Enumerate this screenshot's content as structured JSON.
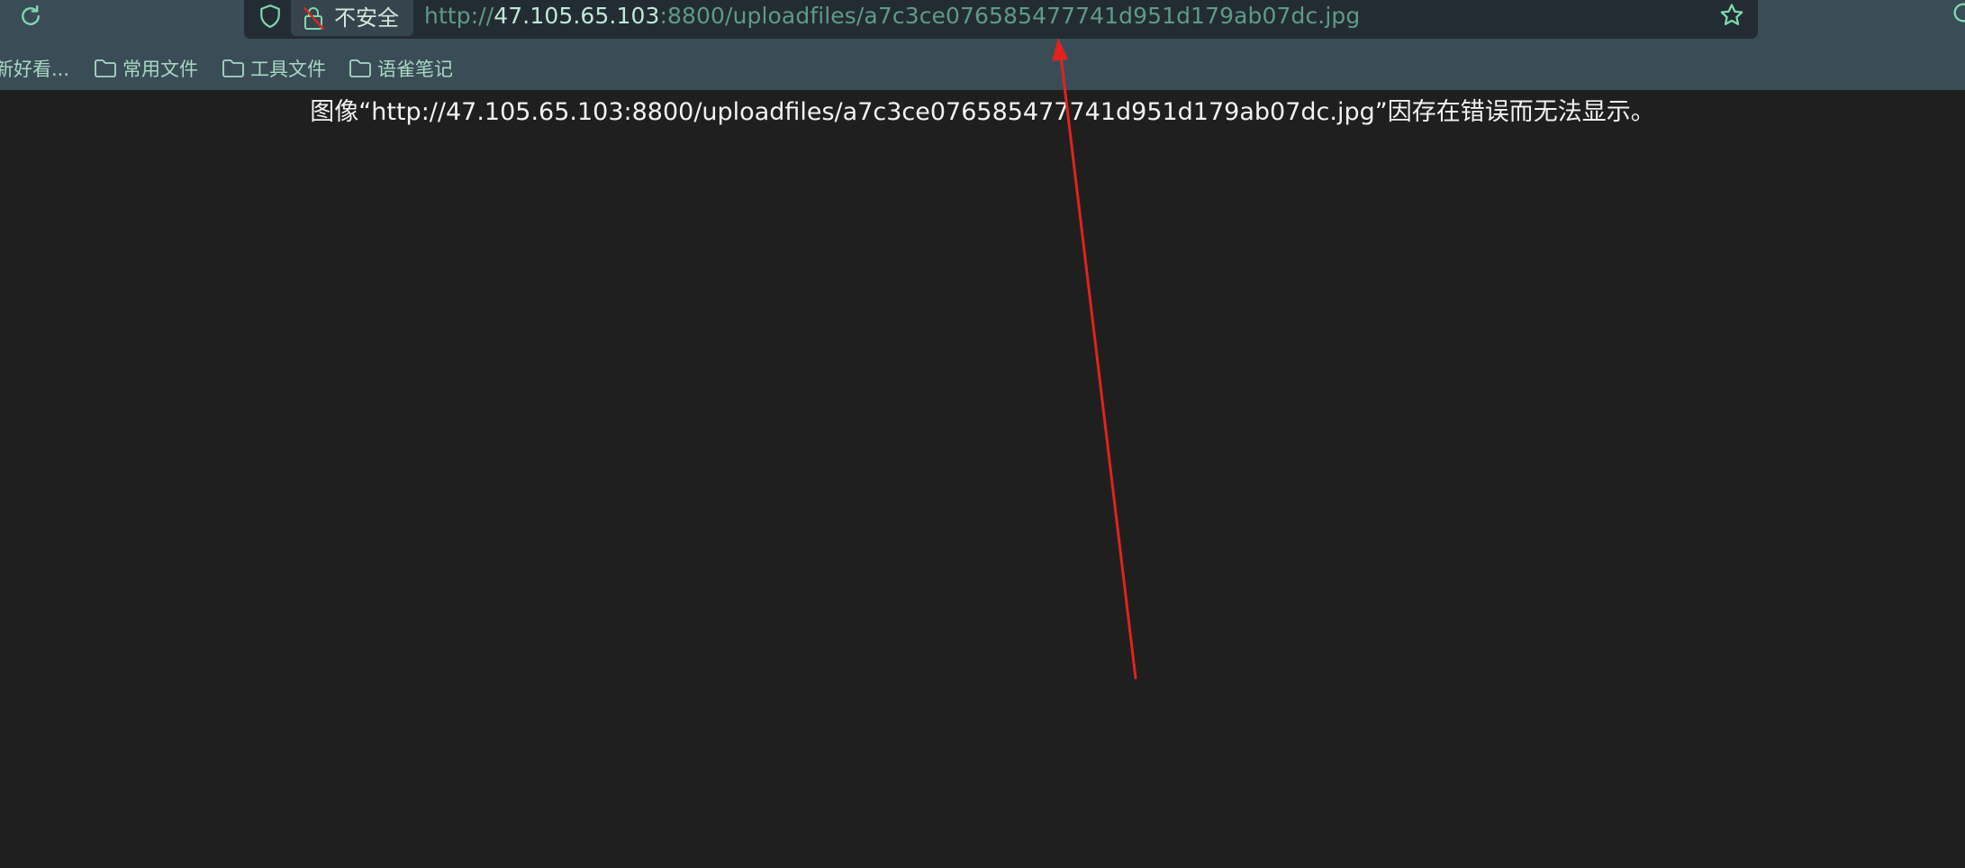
{
  "toolbar": {
    "security_label": "不安全",
    "url_scheme": "http://",
    "url_host": "47.105.65.103",
    "url_path": ":8800/uploadfiles/a7c3ce076585477741d951d179ab07dc.jpg"
  },
  "bookmarks": [
    {
      "label": "新好看..."
    },
    {
      "label": "常用文件"
    },
    {
      "label": "工具文件"
    },
    {
      "label": "语雀笔记"
    }
  ],
  "content": {
    "error_message": "图像“http://47.105.65.103:8800/uploadfiles/a7c3ce076585477741d951d179ab07dc.jpg”因存在错误而无法显示。"
  },
  "colors": {
    "toolbar_bg": "#3a4d57",
    "urlbar_bg": "#242c33",
    "page_bg": "#1f1f1f",
    "accent_green": "#7fd8b0",
    "annotation_arrow": "#e0231e"
  },
  "icons": [
    "reload-icon",
    "shield-icon",
    "insecure-lock-icon",
    "star-icon",
    "folder-icon",
    "annotation-arrow"
  ]
}
